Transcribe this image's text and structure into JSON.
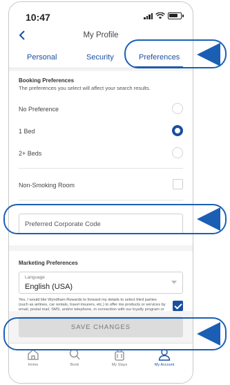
{
  "status_bar": {
    "time": "10:47"
  },
  "header": {
    "title": "My Profile"
  },
  "tabs": [
    {
      "label": "Personal"
    },
    {
      "label": "Security"
    },
    {
      "label": "Preferences",
      "active": true
    }
  ],
  "booking": {
    "title": "Booking Preferences",
    "description": "The preferences you select will affect your search results.",
    "options": [
      {
        "label": "No Preference",
        "selected": false
      },
      {
        "label": "1 Bed",
        "selected": true
      },
      {
        "label": "2+ Beds",
        "selected": false
      }
    ],
    "non_smoking": {
      "label": "Non-Smoking Room",
      "checked": false
    }
  },
  "corporate_code": {
    "placeholder": "Preferred Corporate Code"
  },
  "marketing": {
    "title": "Marketing Preferences",
    "language": {
      "caption": "Language",
      "value": "English (USA)"
    },
    "consent": {
      "text": "Yes, I would like Wyndham Rewards to forward my details to select third parties (such as airlines, car rentals, travel insurers, etc.) to offer me products or services by email, postal mail, SMS, and/or telephone, in connection with our loyalty program or a",
      "checked": true
    }
  },
  "actions": {
    "save_label": "SAVE CHANGES"
  },
  "bottom_nav": [
    {
      "label": "Home",
      "icon": "home-icon"
    },
    {
      "label": "Book",
      "icon": "search-icon"
    },
    {
      "label": "My Stays",
      "icon": "suitcase-icon"
    },
    {
      "label": "My Account",
      "icon": "person-icon",
      "active": true
    }
  ],
  "colors": {
    "accent": "#1a4fa0",
    "callout": "#1a5fb4",
    "disabled_button": "#dcdcdc"
  }
}
